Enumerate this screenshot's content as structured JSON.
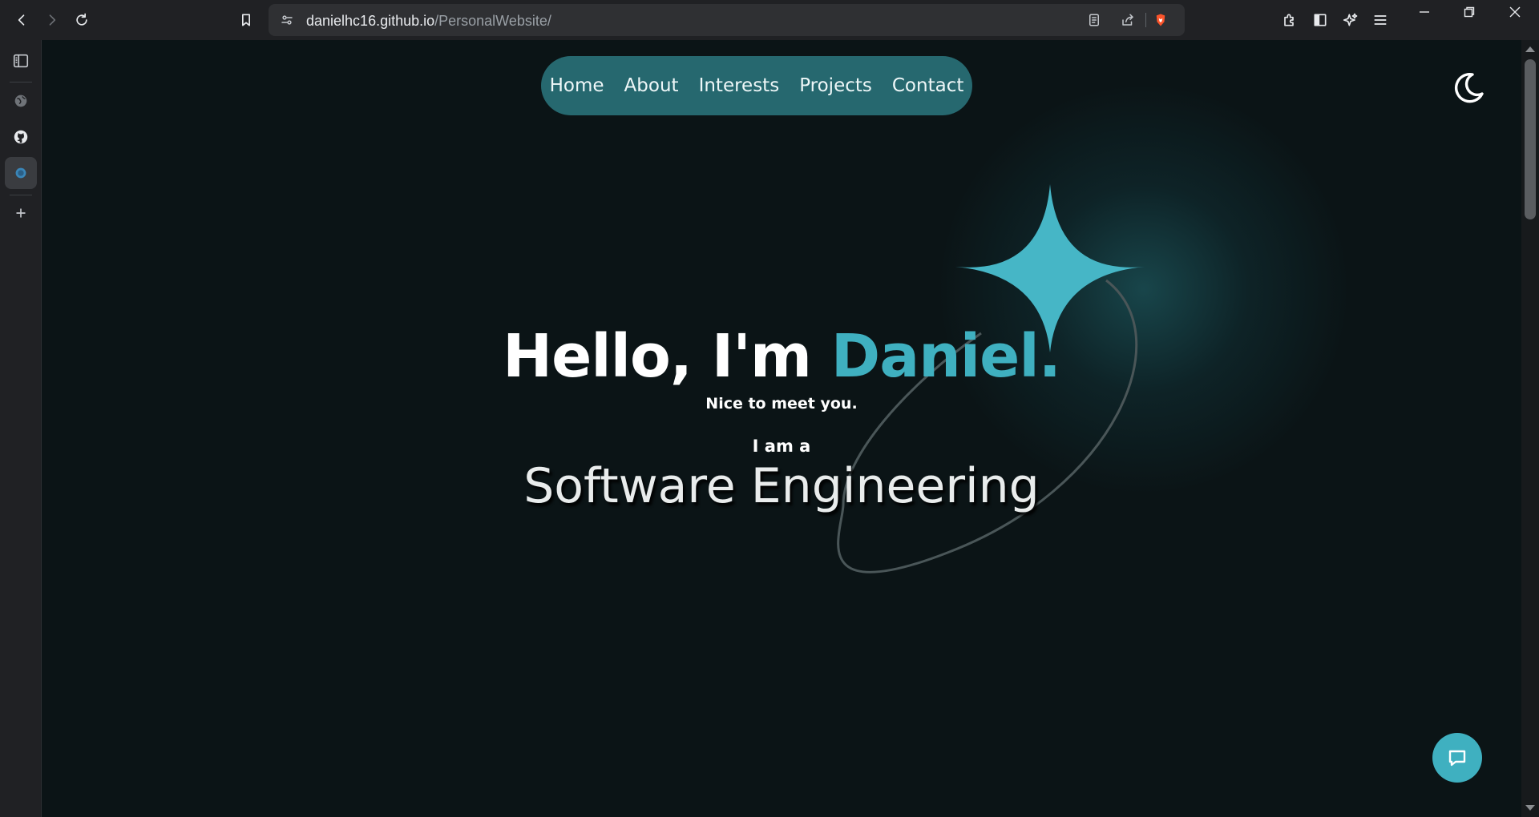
{
  "browser": {
    "url_host": "danielhc16.github.io",
    "url_path": "/PersonalWebsite/",
    "icons": [
      "back-icon",
      "forward-icon",
      "reload-icon",
      "bookmark-icon",
      "site-settings-icon",
      "reader-mode-icon",
      "share-icon",
      "brave-shields-icon",
      "extensions-icon",
      "sidebar-toggle-icon",
      "leo-ai-icon",
      "menu-icon",
      "minimize-icon",
      "restore-icon",
      "close-icon"
    ]
  },
  "sidepanel": {
    "icons": [
      "sidebar-panel-icon",
      "globe-icon",
      "github-icon",
      "site-icon",
      "add-icon"
    ]
  },
  "nav": {
    "items": [
      {
        "label": "Home"
      },
      {
        "label": "About"
      },
      {
        "label": "Interests"
      },
      {
        "label": "Projects"
      },
      {
        "label": "Contact"
      }
    ]
  },
  "hero": {
    "greeting": "Hello, I'm ",
    "name": "Daniel.",
    "subtitle": "Nice to meet you.",
    "i_am": "I am a",
    "role": "Software Engineering"
  },
  "colors": {
    "accent": "#3fb0c0",
    "nav_bg": "#26686f",
    "page_bg": "#0b1416"
  },
  "icons": {
    "theme_toggle": "moon-icon",
    "chat": "chat-icon"
  }
}
